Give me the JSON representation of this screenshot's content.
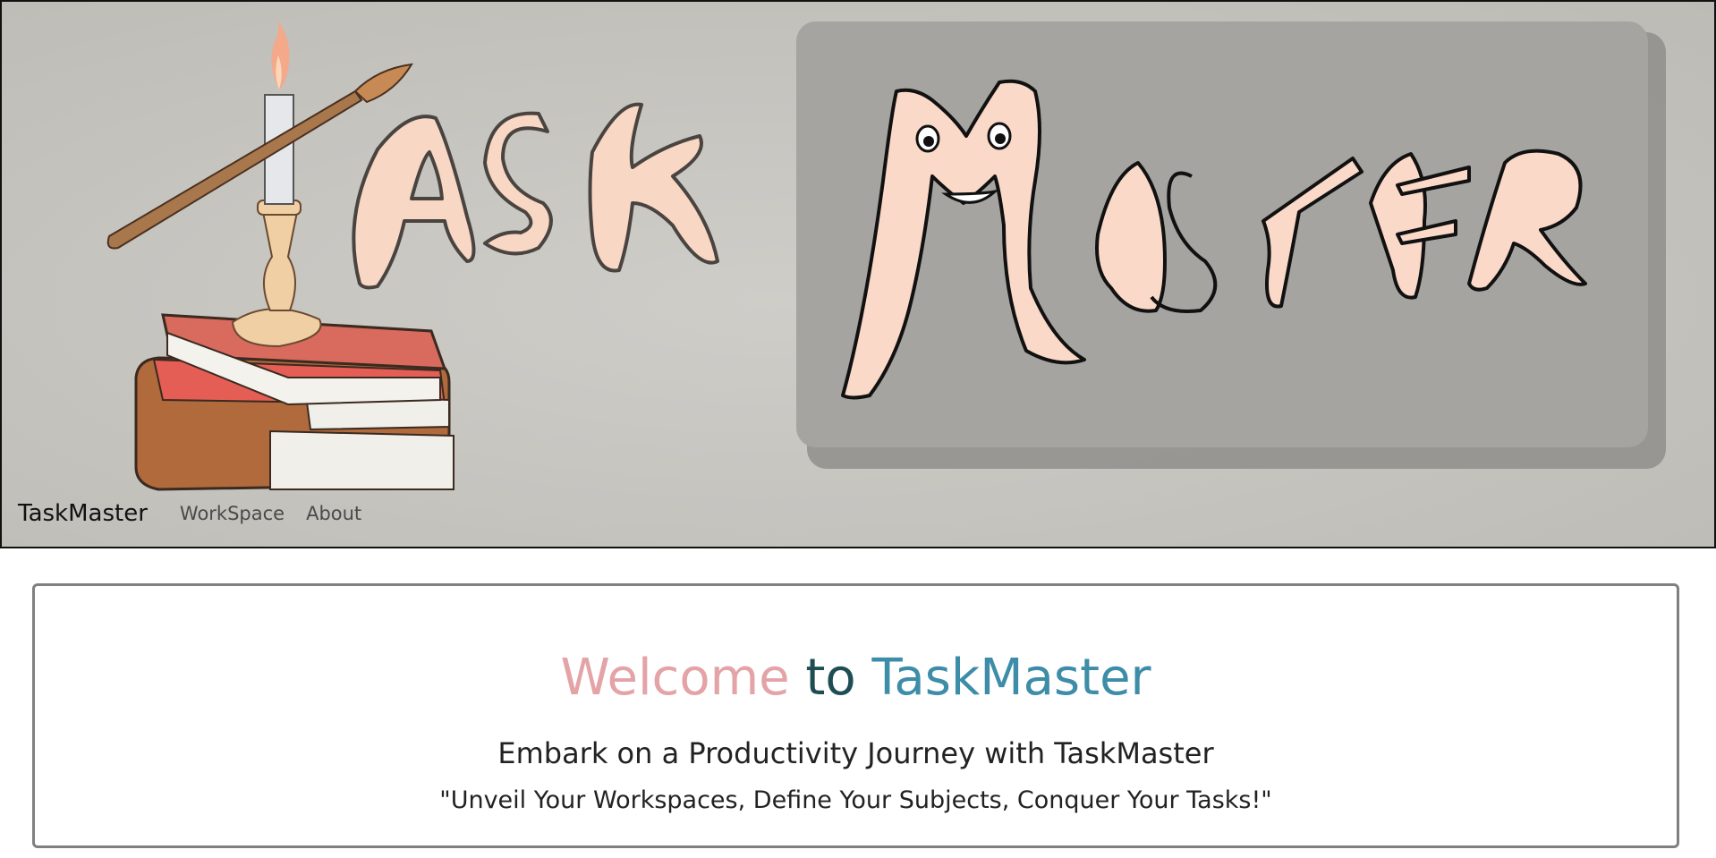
{
  "navbar": {
    "brand": "TaskMaster",
    "links": [
      {
        "label": "WorkSpace"
      },
      {
        "label": "About"
      }
    ]
  },
  "banner": {
    "logo_left_text": "TASK",
    "logo_right_text": "MASTER"
  },
  "welcome": {
    "title_part1": "Welcome",
    "title_part2": "to",
    "title_part3": "TaskMaster",
    "subtitle": "Embark on a Productivity Journey with TaskMaster",
    "tagline": "\"Unveil Your Workspaces, Define Your Subjects, Conquer Your Tasks!\""
  },
  "colors": {
    "welcome": "#e4a3a6",
    "to": "#1f4d54",
    "taskmaster": "#3d8ca8",
    "banner_bg": "#c6c4bf",
    "letter_fill": "#f8d7c4"
  }
}
